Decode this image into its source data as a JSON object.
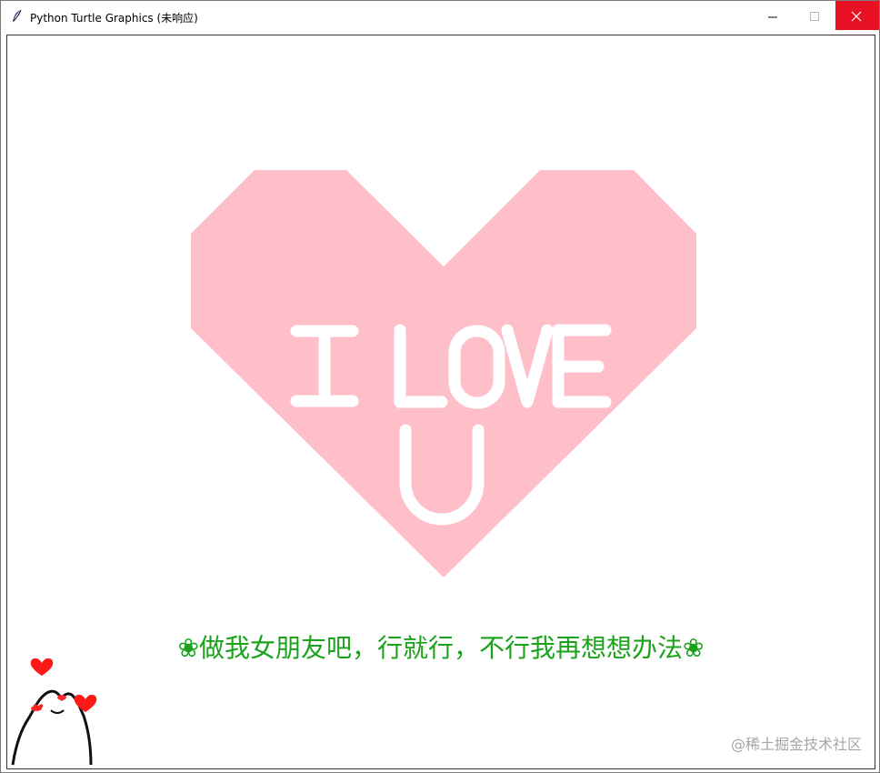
{
  "window": {
    "title": "Python Turtle Graphics (未响应)",
    "controls": [
      "minimize",
      "maximize",
      "close"
    ]
  },
  "canvas": {
    "heart_color": "#ffbfc8",
    "heart_text": "I LOVE U",
    "caption": "❀做我女朋友吧，行就行，不行我再想想办法❀",
    "caption_color": "#1aa31a",
    "watermark": "@稀土掘金技术社区"
  },
  "icons": [
    "feather-icon",
    "minimize-icon",
    "maximize-icon",
    "close-icon"
  ]
}
